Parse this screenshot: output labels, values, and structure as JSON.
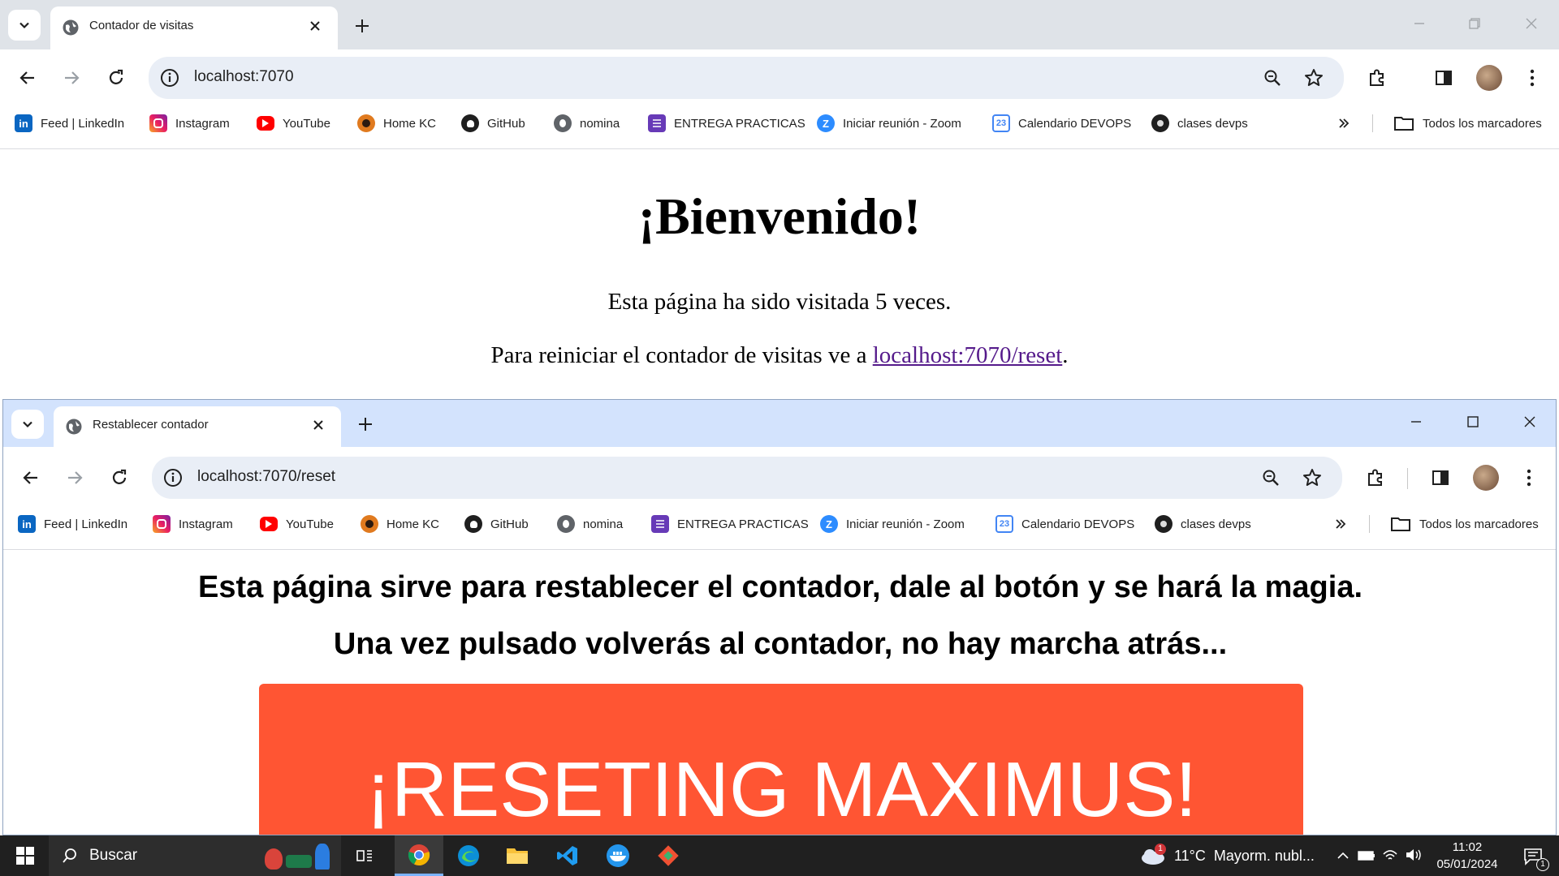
{
  "back_window": {
    "tab_title": "Contador de visitas",
    "url": "localhost:7070",
    "page": {
      "heading": "¡Bienvenido!",
      "visits_text": "Esta página ha sido visitada 5 veces.",
      "reset_prefix": "Para reiniciar el contador de visitas ve a ",
      "reset_link": "localhost:7070/reset",
      "reset_suffix": "."
    }
  },
  "front_window": {
    "tab_title": "Restablecer contador",
    "url": "localhost:7070/reset",
    "page": {
      "line1": "Esta página sirve para restablecer el contador, dale al botón y se hará la magia.",
      "line2": "Una vez pulsado volverás al contador, no hay marcha atrás...",
      "button_label": "¡RESETING MAXIMUS!",
      "button_color": "#ff5533"
    }
  },
  "bookmarks": [
    {
      "label": "Feed | LinkedIn",
      "icon": "linkedin-icon"
    },
    {
      "label": "Instagram",
      "icon": "instagram-icon"
    },
    {
      "label": "YouTube",
      "icon": "youtube-icon"
    },
    {
      "label": "Home KC",
      "icon": "keepcoding-icon"
    },
    {
      "label": "GitHub",
      "icon": "github-icon"
    },
    {
      "label": "nomina",
      "icon": "globe-icon"
    },
    {
      "label": "ENTREGA PRACTICAS",
      "icon": "forms-icon"
    },
    {
      "label": "Iniciar reunión - Zoom",
      "icon": "zoom-icon"
    },
    {
      "label": "Calendario DEVOPS",
      "icon": "calendar-icon"
    },
    {
      "label": "clases devps",
      "icon": "avatar-icon"
    }
  ],
  "all_bookmarks_label": "Todos los marcadores",
  "colors": {
    "tabstrip_back": "#dfe3e8",
    "tabstrip_front": "#d3e3fd",
    "omnibox": "#e9eef6",
    "link": "#551a8b",
    "taskbar": "#202020"
  },
  "taskbar": {
    "search_placeholder": "Buscar",
    "weather": "11°C  Mayorm. nubl...",
    "weather_badge": "1",
    "time": "11:02",
    "date": "05/01/2024",
    "notification_count": "1"
  }
}
